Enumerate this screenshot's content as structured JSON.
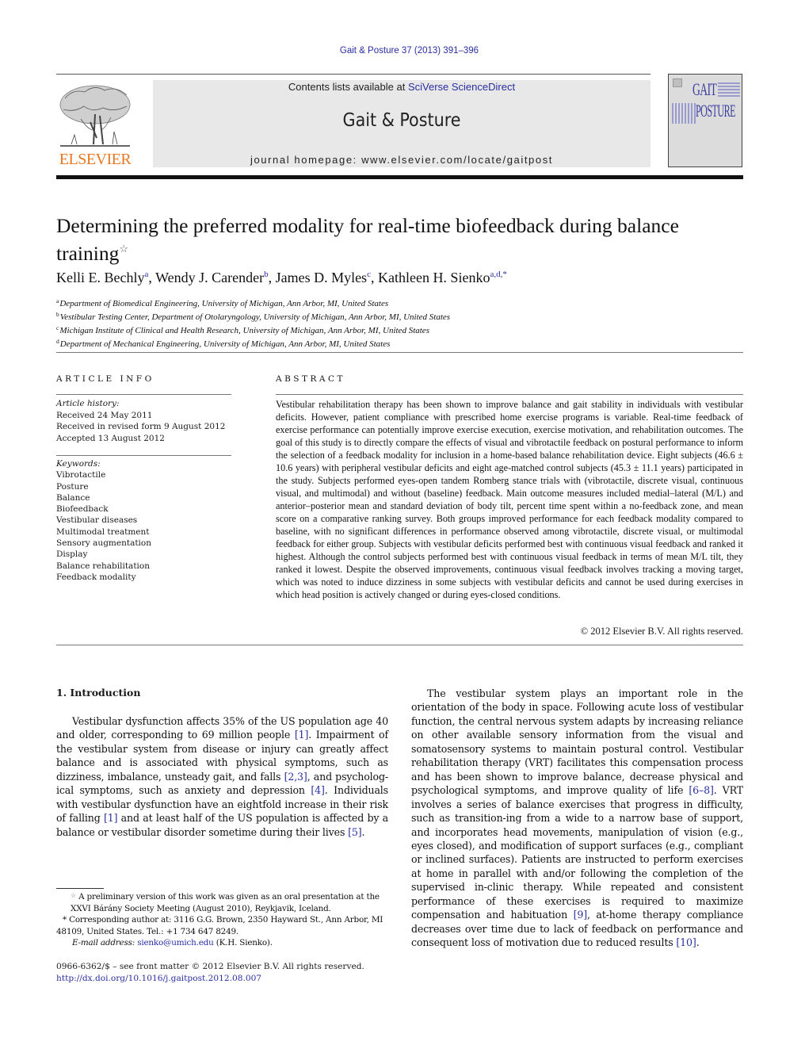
{
  "header": {
    "journal_ref": "Gait & Posture 37 (2013) 391–396",
    "contents_prefix": "Contents lists available at ",
    "contents_link": "SciVerse ScienceDirect",
    "journal_title": "Gait & Posture",
    "homepage": "journal homepage: www.elsevier.com/locate/gaitpost",
    "publisher_logo_text": "ELSEVIER",
    "cover_title_line1": "GAIT",
    "cover_title_line2": "POSTURE",
    "colors": {
      "link": "#2a2ea0",
      "publisher_orange": "#e87722",
      "masthead_bg": "#e8e8e8"
    }
  },
  "article": {
    "title": "Determining the preferred modality for real-time biofeedback during balance training",
    "title_mark": "☆",
    "authors": [
      {
        "name": "Kelli E. Bechly",
        "aff": "a",
        "sep": ", "
      },
      {
        "name": "Wendy J. Carender",
        "aff": "b",
        "sep": ", "
      },
      {
        "name": "James D. Myles",
        "aff": "c",
        "sep": ", "
      },
      {
        "name": "Kathleen H. Sienko",
        "aff": "a,d,*",
        "sep": ""
      }
    ],
    "affiliations": [
      {
        "mark": "a",
        "text": "Department of Biomedical Engineering, University of Michigan, Ann Arbor, MI, United States"
      },
      {
        "mark": "b",
        "text": "Vestibular Testing Center, Department of Otolaryngology, University of Michigan, Ann Arbor, MI, United States"
      },
      {
        "mark": "c",
        "text": "Michigan Institute of Clinical and Health Research, University of Michigan, Ann Arbor, MI, United States"
      },
      {
        "mark": "d",
        "text": "Department of Mechanical Engineering, University of Michigan, Ann Arbor, MI, United States"
      }
    ]
  },
  "article_info": {
    "heading": "ARTICLE INFO",
    "history_label": "Article history:",
    "history": [
      "Received 24 May 2011",
      "Received in revised form 9 August 2012",
      "Accepted 13 August 2012"
    ],
    "keywords_label": "Keywords:",
    "keywords": [
      "Vibrotactile",
      "Posture",
      "Balance",
      "Biofeedback",
      "Vestibular diseases",
      "Multimodal treatment",
      "Sensory augmentation",
      "Display",
      "Balance rehabilitation",
      "Feedback modality"
    ]
  },
  "abstract": {
    "heading": "ABSTRACT",
    "text": "Vestibular rehabilitation therapy has been shown to improve balance and gait stability in individuals with vestibular deficits. However, patient compliance with prescribed home exercise programs is variable. Real-time feedback of exercise performance can potentially improve exercise execution, exercise motivation, and rehabilitation outcomes. The goal of this study is to directly compare the effects of visual and vibrotactile feedback on postural performance to inform the selection of a feedback modality for inclusion in a home-based balance rehabilitation device. Eight subjects (46.6 ± 10.6 years) with peripheral vestibular deficits and eight age-matched control subjects (45.3 ± 11.1 years) participated in the study. Subjects performed eyes-open tandem Romberg stance trials with (vibrotactile, discrete visual, continuous visual, and multimodal) and without (baseline) feedback. Main outcome measures included medial–lateral (M/L) and anterior–posterior mean and standard deviation of body tilt, percent time spent within a no-feedback zone, and mean score on a comparative ranking survey. Both groups improved performance for each feedback modality compared to baseline, with no significant differences in performance observed among vibrotactile, discrete visual, or multimodal feedback for either group. Subjects with vestibular deficits performed best with continuous visual feedback and ranked it highest. Although the control subjects performed best with continuous visual feedback in terms of mean M/L tilt, they ranked it lowest. Despite the observed improvements, continuous visual feedback involves tracking a moving target, which was noted to induce dizziness in some subjects with vestibular deficits and cannot be used during exercises in which head position is actively changed or during eyes-closed conditions.",
    "copyright": "© 2012 Elsevier B.V. All rights reserved."
  },
  "body": {
    "section_heading": "1.  Introduction",
    "left_paragraph": [
      {
        "t": "Vestibular dysfunction affects 35% of the US population age 40 and older, corresponding to 69 million people "
      },
      {
        "ref": "[1]"
      },
      {
        "t": ". Impairment of the vestibular system from disease or injury can greatly affect balance and is associated with physical symptoms, such as dizziness, imbalance, unsteady gait, and falls "
      },
      {
        "ref": "[2,3]"
      },
      {
        "t": ", and psycholog-ical symptoms, such as anxiety and depression "
      },
      {
        "ref": "[4]"
      },
      {
        "t": ". Individuals with vestibular dysfunction have an eightfold increase in their risk of falling "
      },
      {
        "ref": "[1]"
      },
      {
        "t": " and at least half of the US population is affected by a balance or vestibular disorder sometime during their lives "
      },
      {
        "ref": "[5]"
      },
      {
        "t": "."
      }
    ],
    "right_paragraph": [
      {
        "t": "The vestibular system plays an important role in the orientation of the body in space. Following acute loss of vestibular function, the central nervous system adapts by increasing reliance on other available sensory information from the visual and somatosensory systems to maintain postural control. Vestibular rehabilitation therapy (VRT) facilitates this compensation process and has been shown to improve balance, decrease physical and psychological symptoms, and improve quality of life "
      },
      {
        "ref": "[6–8]"
      },
      {
        "t": ". VRT involves a series of balance exercises that progress in difficulty, such as transition-ing from a wide to a narrow base of support, and incorporates head movements, manipulation of vision (e.g., eyes closed), and modification of support surfaces (e.g., compliant or inclined surfaces). Patients are instructed to perform exercises at home in parallel with and/or following the completion of the supervised in-clinic therapy. While repeated and consistent performance of these exercises is required to maximize compensation and habituation "
      },
      {
        "ref": "[9]"
      },
      {
        "t": ", at-home therapy compliance decreases over time due to lack of feedback on performance and consequent loss of motivation due to reduced results "
      },
      {
        "ref": "[10]"
      },
      {
        "t": "."
      }
    ]
  },
  "footnotes": {
    "star_mark": "☆",
    "star_text": "A preliminary version of this work was given as an oral presentation at the XXVI Bárány Society Meeting (August 2010), Reykjavik, Iceland.",
    "corresponding_mark": "*",
    "corresponding_text": "Corresponding author at: 3116 G.G. Brown, 2350 Hayward St., Ann Arbor, MI 48109, United States. Tel.: +1 734 647 8249.",
    "email_label": "E-mail address:",
    "email": "sienko@umich.edu",
    "email_suffix": " (K.H. Sienko)."
  },
  "legal": {
    "issn_line": "0966-6362/$ – see front matter © 2012 Elsevier B.V. All rights reserved.",
    "doi": "http://dx.doi.org/10.1016/j.gaitpost.2012.08.007"
  }
}
